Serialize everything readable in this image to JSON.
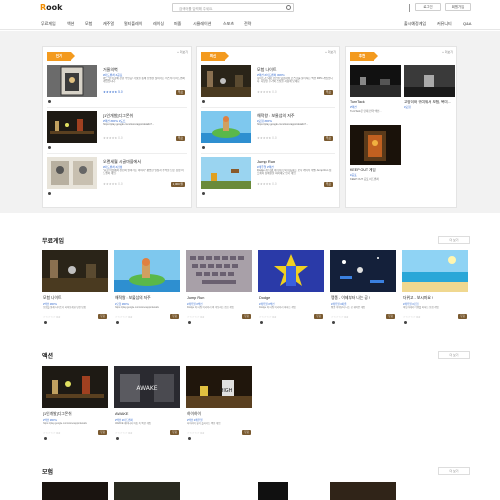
{
  "header": {
    "logo_prefix": "R",
    "logo_suffix": "ook",
    "search_placeholder": "검색어를 입력해 주세요.",
    "login_label": "로그인",
    "join_label": "회원가입"
  },
  "nav": {
    "left": [
      "무료게임",
      "액션",
      "모험",
      "캐주얼",
      "멀티플레이",
      "레이싱",
      "퍼즐",
      "시뮬레이션",
      "스포츠",
      "전략"
    ],
    "right": [
      "출시예정게임",
      "커뮤니티",
      "Q&A"
    ]
  },
  "hero": {
    "more_label": "+ 더보기",
    "col1": {
      "ribbon": "인기",
      "cards": [
        {
          "title": "거울의벽",
          "tags": "#어드벤처 #공포",
          "desc": "어느 날 미궁에 갇힌 주인공! 거울을 통해 진실을 찾아가는 미스터리 어드벤처 게임입니다.",
          "stars": "★★★★★ 5.0",
          "price": "무료"
        },
        {
          "title": "[1인개발]디그몬쉬",
          "tags": "#액션 #RPG #도트",
          "desc": "https://play.google.com/store/apps/details?...",
          "stars": "★★★★★ 0.0",
          "price": "무료"
        },
        {
          "title": "오랜세월 시골마을에서",
          "tags": "#어드벤처 #감성",
          "desc": "\"시골 마을에서 천천히 살아가는 이야기\" 평범한 일상과 추억을 담은 감성 어드벤처 게임.",
          "stars": "★★★★★ 0.0",
          "price": "1,000 원"
        }
      ]
    },
    "col2": {
      "ribbon": "최신",
      "cards": [
        {
          "title": "모험 나이트",
          "tags": "#액션 #어드벤처 #RPG",
          "desc": "나이트가 되어 던전을 탐험하며 몬스터를 물리치는 액션 RPG 게임입니다. 다양한 무기와 스킬을 사용해 보세요.",
          "stars": "★★★★★ 0.0",
          "price": "무료"
        },
        {
          "title": "해적왕 : 보물섬의 저주",
          "tags": "#모험 #RPG",
          "desc": "https://play.google.com/store/apps/details?...",
          "stars": "★★★★★ 0.0",
          "price": "무료"
        },
        {
          "title": "Jump Run",
          "tags": "#캐주얼 #액션",
          "desc": "Dodge 쳐 타워 이리저리 외 이동하는 보나 캐릭터 레벨 Jump Run 점프해서 장애물을 피하세요 인기 게임",
          "stars": "★★★★★ 0.0",
          "price": "무료"
        }
      ]
    },
    "col3": {
      "ribbon": "추천",
      "items": [
        {
          "title": "TurnTack",
          "tag": "#액션",
          "desc": "TurnTack은 턴제 전략 액션..."
        },
        {
          "title": "고양이와 귀여워서 모험, 복미...",
          "tag": "#모험",
          "desc": "고양이와 함께하는 모험"
        },
        {
          "title": "KEEP OUT 게임",
          "tag": "#공포",
          "desc": "KEEP OUT 공포 어드벤처"
        }
      ]
    }
  },
  "sections": [
    {
      "title": "무료게임",
      "more": "더 보기",
      "cards": [
        {
          "title": "모험 나이트",
          "tags": "#액션 #RPG",
          "desc": "모험을 통해 나이트가 되어보세요 던전 탐험",
          "stars": "☆☆☆☆☆ 0.0",
          "price": "무료"
        },
        {
          "title": "해적왕 : 보물섬의 저주",
          "tags": "#모험 #RPG",
          "desc": "https://play.google.com/store/apps/details",
          "stars": "☆☆☆☆☆ 0.0",
          "price": "무료"
        },
        {
          "title": "Jump Run",
          "tags": "#캐주얼 #액션",
          "desc": "Dodge 쳐 타워 이리저리 외 이동하는 점프 게임",
          "stars": "☆☆☆☆☆ 0.0",
          "price": "무료"
        },
        {
          "title": "Dodge",
          "tags": "#캐주얼 #액션",
          "desc": "Dodge 쳐 타워 이리저리 피하는 게임",
          "stars": "☆☆☆☆☆ 0.0",
          "price": "무료"
        },
        {
          "title": "펭퐁 - 이제부터 나는 공 !",
          "tags": "#캐주얼 #퍼즐",
          "desc": "펭퐁 이제부터 나는 공 귀여운 게임",
          "stars": "☆☆☆☆☆ 0.0",
          "price": "무료"
        },
        {
          "title": "더위고 - 보시마요 !",
          "tags": "#캐주얼 #모험",
          "desc": "바닷가에서 더위를 피하는 모험 게임",
          "stars": "☆☆☆☆☆ 0.0",
          "price": "무료"
        }
      ]
    },
    {
      "title": "액션",
      "more": "더 보기",
      "cards": [
        {
          "title": "[1인개발]디그몬쉬",
          "tags": "#액션 #RPG",
          "desc": "https://play.google.com/store/apps/details",
          "stars": "☆☆☆☆☆ 0.0",
          "price": "무료"
        },
        {
          "title": "AWAKE",
          "tags": "#액션 #어드벤처",
          "desc": "AWAKE 깨어나라 어둠 속 액션 게임",
          "stars": "☆☆☆☆☆ 0.0",
          "price": "무료"
        },
        {
          "title": "하이하이",
          "tags": "#액션 #캐주얼",
          "desc": "하이하이 높이 올라가는 액션 게임",
          "stars": "☆☆☆☆☆ 0.0",
          "price": "무료"
        }
      ]
    },
    {
      "title": "모험",
      "more": "더 보기",
      "cards": []
    }
  ]
}
